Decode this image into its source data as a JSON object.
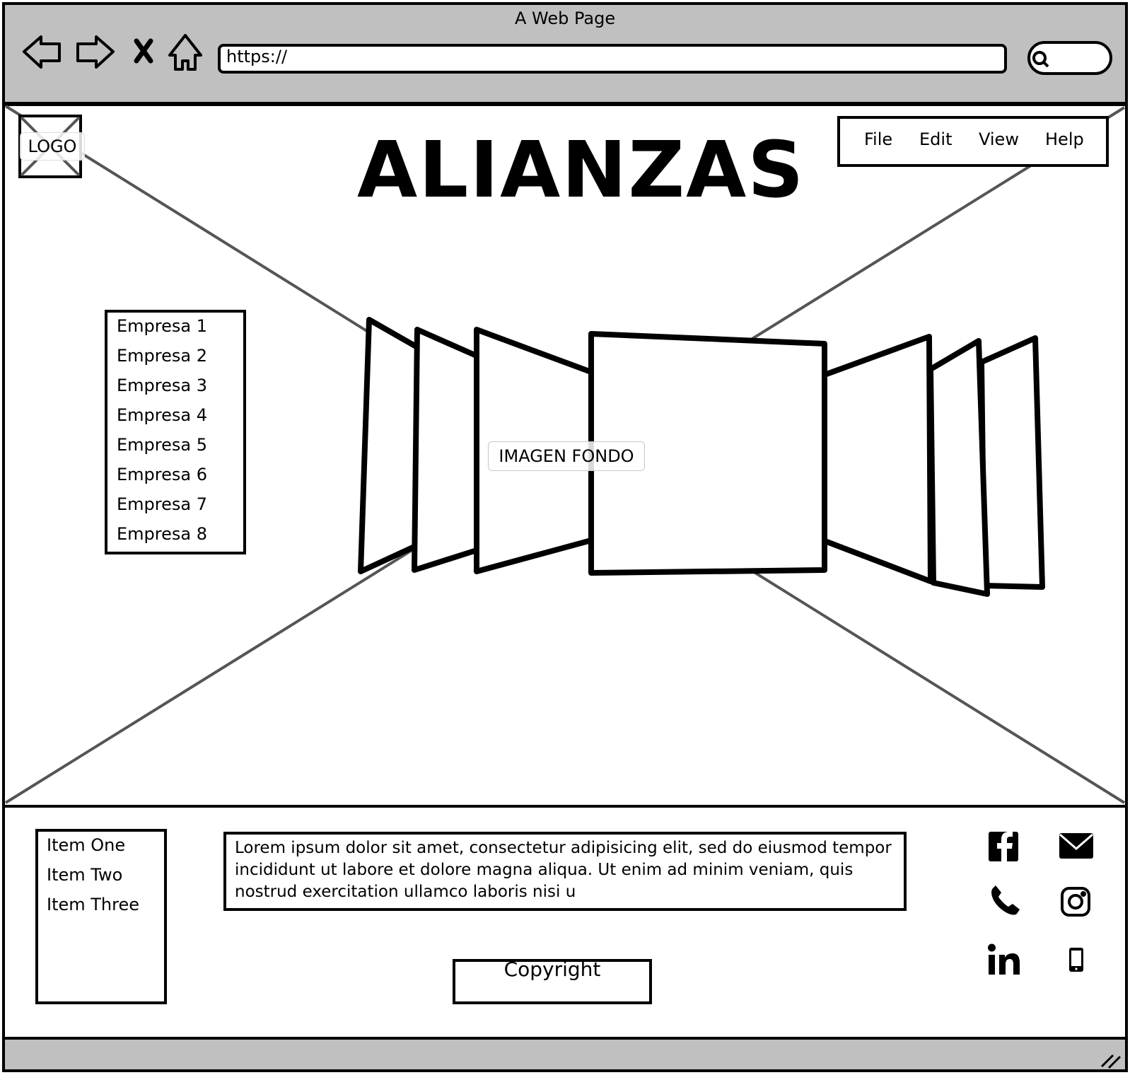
{
  "browser": {
    "window_title": "A Web Page",
    "address_bar": "https://"
  },
  "header": {
    "logo": "LOGO",
    "heading": "ALIANZAS",
    "menu": [
      "File",
      "Edit",
      "View",
      "Help"
    ]
  },
  "main": {
    "companies": [
      "Empresa 1",
      "Empresa 2",
      "Empresa 3",
      "Empresa 4",
      "Empresa 5",
      "Empresa 6",
      "Empresa 7",
      "Empresa 8"
    ],
    "background_label": "IMAGEN FONDO"
  },
  "footer": {
    "items": [
      "Item One",
      "Item Two",
      "Item Three"
    ],
    "text": "Lorem ipsum dolor sit amet, consectetur adipisicing elit, sed do eiusmod tempor incididunt ut labore et dolore magna aliqua. Ut enim ad minim veniam, quis nostrud exercitation ullamco laboris nisi u",
    "copyright": "Copyright",
    "social_icons": [
      "facebook-icon",
      "mail-icon",
      "phone-icon",
      "instagram-icon",
      "linkedin-icon",
      "mobile-icon"
    ]
  },
  "colors": {
    "chrome_gray": "#c0c0c0",
    "stroke": "#000000",
    "placeholder_line": "#555555"
  }
}
